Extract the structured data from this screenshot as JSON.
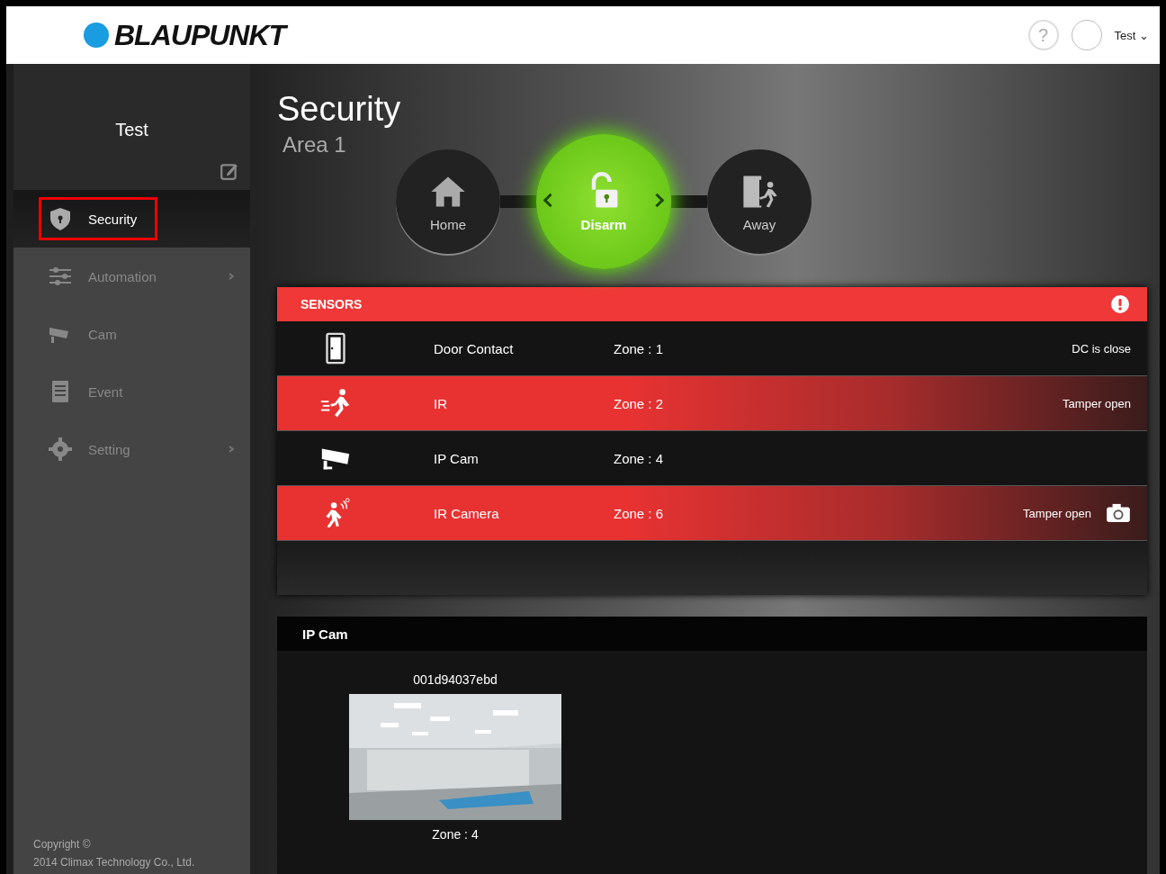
{
  "header": {
    "logo": "BLAUPUNKT",
    "help": "?",
    "user": "Test",
    "caret": "⌄"
  },
  "sidebar": {
    "user_name": "Test",
    "items": [
      {
        "label": "Security",
        "kind": "shield",
        "selected": true,
        "submenu": false
      },
      {
        "label": "Automation",
        "kind": "sliders",
        "selected": false,
        "submenu": true
      },
      {
        "label": "Cam",
        "kind": "camera",
        "selected": false,
        "submenu": false
      },
      {
        "label": "Event",
        "kind": "list",
        "selected": false,
        "submenu": false
      },
      {
        "label": "Setting",
        "kind": "gear",
        "selected": false,
        "submenu": true
      }
    ],
    "copyright": [
      "Copyright ©",
      "2014 Climax Technology Co., Ltd."
    ]
  },
  "page": {
    "title": "Security",
    "subtitle": "Area 1"
  },
  "modes": [
    {
      "label": "Home",
      "kind": "home",
      "selected": false
    },
    {
      "label": "Disarm",
      "kind": "unlock",
      "selected": true
    },
    {
      "label": "Away",
      "kind": "away",
      "selected": false
    }
  ],
  "sensors": {
    "title": "SENSORS",
    "alert": true,
    "rows": [
      {
        "kind": "door",
        "name": "Door Contact",
        "zone": "Zone : 1",
        "status": "DC is close",
        "alarm": false,
        "snapshot": false
      },
      {
        "kind": "ir",
        "name": "IR",
        "zone": "Zone : 2",
        "status": "Tamper open",
        "alarm": true,
        "snapshot": false
      },
      {
        "kind": "ipcam",
        "name": "IP Cam",
        "zone": "Zone : 4",
        "status": "",
        "alarm": false,
        "snapshot": false
      },
      {
        "kind": "ircam",
        "name": "IR Camera",
        "zone": "Zone : 6",
        "status": "Tamper open",
        "alarm": true,
        "snapshot": true
      }
    ]
  },
  "ip_cam": {
    "title": "IP Cam",
    "cameras": [
      {
        "id": "001d94037ebd",
        "zone": "Zone : 4",
        "kind": "picture"
      }
    ]
  }
}
